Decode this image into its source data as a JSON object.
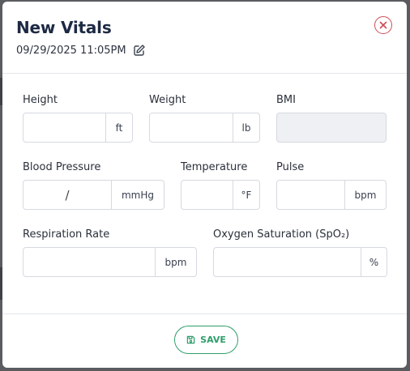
{
  "modal": {
    "title": "New Vitals",
    "datetime": "09/29/2025 11:05PM"
  },
  "fields": {
    "height": {
      "label": "Height",
      "value": "",
      "unit": "ft"
    },
    "weight": {
      "label": "Weight",
      "value": "",
      "unit": "lb"
    },
    "bmi": {
      "label": "BMI",
      "value": ""
    },
    "blood_pressure": {
      "label": "Blood Pressure",
      "systolic": "",
      "separator": "/",
      "diastolic": "",
      "unit": "mmHg"
    },
    "temperature": {
      "label": "Temperature",
      "value": "",
      "unit": "°F"
    },
    "pulse": {
      "label": "Pulse",
      "value": "",
      "unit": "bpm"
    },
    "respiration_rate": {
      "label": "Respiration Rate",
      "value": "",
      "unit": "bpm"
    },
    "oxygen_saturation": {
      "label": "Oxygen Saturation (SpO₂)",
      "value": "",
      "unit": "%"
    }
  },
  "footer": {
    "save_label": "SAVE"
  },
  "icons": {
    "edit": "edit-icon",
    "close": "close-icon",
    "save": "save-icon"
  },
  "colors": {
    "title": "#1e2a44",
    "close": "#d14b55",
    "save": "#2f9e6a",
    "bmi_bg": "#eef0f3"
  }
}
